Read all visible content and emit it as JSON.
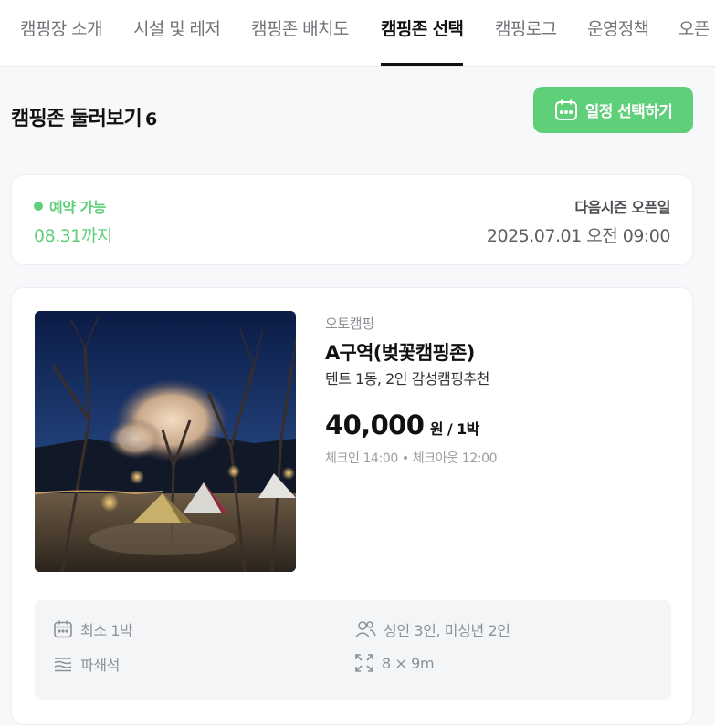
{
  "nav": {
    "tabs": [
      {
        "label": "캠핑장 소개",
        "active": false
      },
      {
        "label": "시설 및 레저",
        "active": false
      },
      {
        "label": "캠핑존 배치도",
        "active": false
      },
      {
        "label": "캠핑존 선택",
        "active": true
      },
      {
        "label": "캠핑로그",
        "active": false
      },
      {
        "label": "운영정책",
        "active": false
      },
      {
        "label": "오픈",
        "active": false
      }
    ]
  },
  "section": {
    "title": "캠핑존 둘러보기",
    "count": "6",
    "pick_date_label": "일정 선택하기"
  },
  "status": {
    "availability": "예약 가능",
    "until": "08.31까지",
    "next_season_label": "다음시즌 오픈일",
    "next_season_date": "2025.07.01 오전 09:00"
  },
  "zone": {
    "type": "오토캠핑",
    "name": "A구역(벚꽃캠핑존)",
    "description": "텐트 1동, 2인 감성캠핑추천",
    "price_amount": "40,000",
    "price_unit": "원 / 1박",
    "checkinout": "체크인 14:00 • 체크아웃 12:00",
    "info": {
      "min_stay": "최소 1박",
      "capacity": "성인 3인, 미성년 2인",
      "floor": "파쇄석",
      "size": "8 × 9m"
    }
  },
  "colors": {
    "accent": "#5fcf7a",
    "background": "#f7f8fa"
  }
}
